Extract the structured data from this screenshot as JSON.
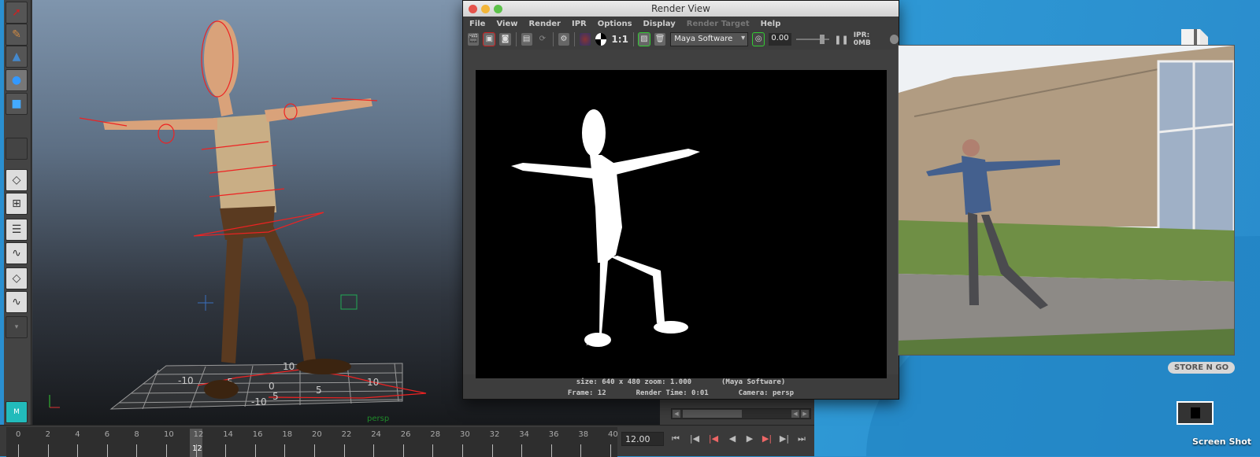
{
  "maya": {
    "viewport_camera": "persp",
    "grid_labels": [
      "10",
      "-5",
      "0",
      "5",
      "-10",
      "10",
      "-10",
      "5"
    ],
    "timeline": {
      "ticks": [
        "0",
        "2",
        "4",
        "6",
        "8",
        "10",
        "12",
        "14",
        "16",
        "18",
        "20",
        "22",
        "24",
        "26",
        "28",
        "30",
        "32",
        "34",
        "36",
        "38",
        "40"
      ],
      "current_frame_marker": "12",
      "current_frame_value": "12.00"
    },
    "playback_buttons": [
      "⏮",
      "|◀",
      "|◀",
      "◀",
      "▶",
      "▶|",
      "▶|",
      "⏭"
    ]
  },
  "render_view": {
    "title": "Render View",
    "menu": [
      "File",
      "View",
      "Render",
      "IPR",
      "Options",
      "Display",
      "Render Target",
      "Help"
    ],
    "toolbar": {
      "ratio_label": "1:1",
      "renderer": "Maya Software",
      "exposure": "0.00",
      "ipr_label": "IPR: 0MB"
    },
    "status_line1_size": "size: 640 x 480 zoom: 1.000",
    "status_line1_renderer": "(Maya Software)",
    "frame": "Frame: 12",
    "render_time": "Render Time: 0:01",
    "camera": "Camera: persp"
  },
  "desktop": {
    "drive_label": "STORE N GO",
    "screenshot_label": "Screen Shot"
  },
  "colors": {
    "desktop_blue": "#2a8fd0",
    "maya_bg": "#3b3b3b"
  }
}
